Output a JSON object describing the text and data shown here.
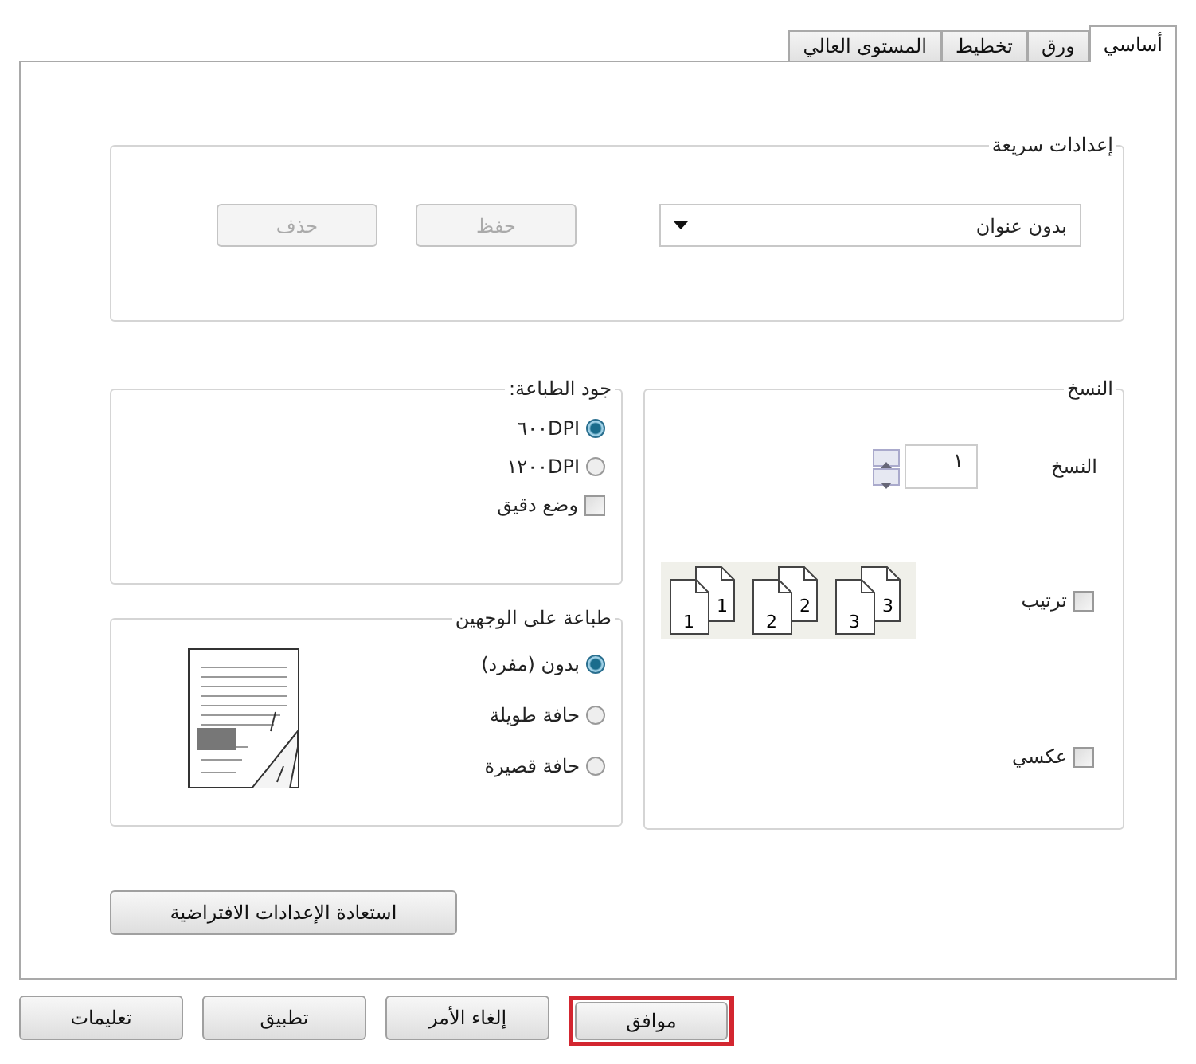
{
  "tabs": [
    {
      "label": "أساسي",
      "selected": true
    },
    {
      "label": "ورق",
      "selected": false
    },
    {
      "label": "تخطيط",
      "selected": false
    },
    {
      "label": "المستوى العالي",
      "selected": false
    }
  ],
  "quick_settings": {
    "title": "إعدادات سريعة",
    "preset": "بدون عنوان",
    "buttons": [
      {
        "label": "حفظ",
        "disabled": true
      },
      {
        "label": "حذف",
        "disabled": true
      }
    ]
  },
  "copies": {
    "title": "النسخ",
    "label": "النسخ",
    "value": "١",
    "collate_pages": [
      {
        "front": "3",
        "back": "3"
      },
      {
        "front": "2",
        "back": "2"
      },
      {
        "front": "1",
        "back": "1"
      }
    ],
    "options": [
      {
        "label": "ترتيب",
        "checked": false,
        "kind": "collate"
      },
      {
        "label": "عكسي",
        "checked": false,
        "kind": "plain"
      }
    ]
  },
  "print_quality": {
    "title": "جود الطباعة:",
    "options": [
      {
        "label": "٦٠٠DPI",
        "selected": true
      },
      {
        "label": "١٢٠٠DPI",
        "selected": false
      }
    ],
    "fine_mode": {
      "label": "وضع دقيق",
      "checked": false
    }
  },
  "duplex": {
    "title": "طباعة على الوجهين",
    "options": [
      {
        "label": "بدون (مفرد)",
        "selected": true
      },
      {
        "label": "حافة طويلة",
        "selected": false
      },
      {
        "label": "حافة قصيرة",
        "selected": false
      }
    ]
  },
  "restore_defaults": "استعادة الإعدادات الافتراضية",
  "buttons": [
    {
      "label": "موافق",
      "highlighted": true
    },
    {
      "label": "إلغاء الأمر",
      "highlighted": false
    },
    {
      "label": "تطبيق",
      "highlighted": false
    },
    {
      "label": "تعليمات",
      "highlighted": false
    }
  ]
}
